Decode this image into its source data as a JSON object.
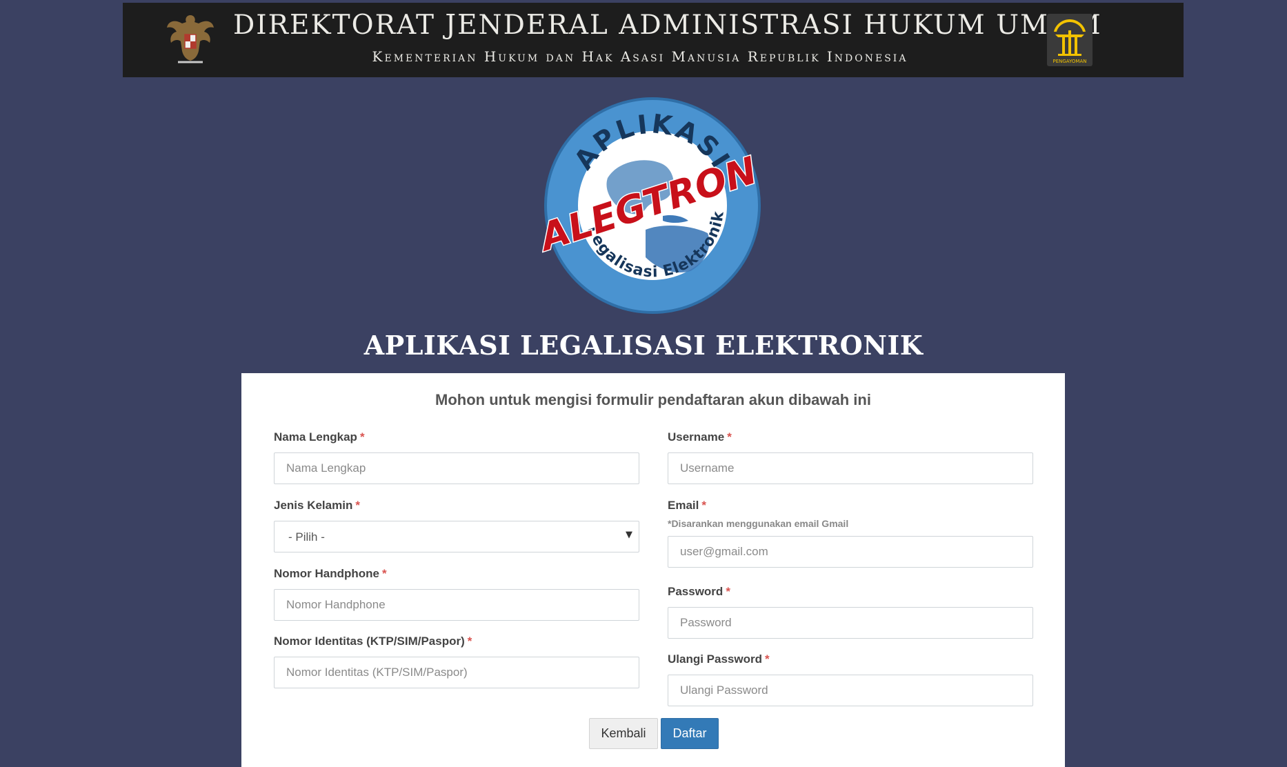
{
  "banner": {
    "title": "DIREKTORAT JENDERAL ADMINISTRASI HUKUM UMUM",
    "subtitle": "Kementerian Hukum dan Hak Asasi Manusia Republik Indonesia",
    "emblem_left": "garuda-pancasila-emblem",
    "emblem_right": "pengayoman-emblem",
    "emblem_right_label": "PENGAYOMAN"
  },
  "logo": {
    "top_text": "APLIKASI",
    "center_text": "ALEGTRON",
    "bottom_text": "Legalisasi Elektronik"
  },
  "app_title": "APLIKASI LEGALISASI ELEKTRONIK",
  "form": {
    "heading": "Mohon untuk mengisi formulir pendaftaran akun dibawah ini",
    "required_marker": "*",
    "fields": {
      "full_name": {
        "label": "Nama Lengkap",
        "placeholder": "Nama Lengkap",
        "value": ""
      },
      "gender": {
        "label": "Jenis Kelamin",
        "selected": "- Pilih -"
      },
      "phone": {
        "label": "Nomor Handphone",
        "placeholder": "Nomor Handphone",
        "value": ""
      },
      "id_number": {
        "label": "Nomor Identitas (KTP/SIM/Paspor)",
        "placeholder": "Nomor Identitas (KTP/SIM/Paspor)",
        "value": ""
      },
      "username": {
        "label": "Username",
        "placeholder": "Username",
        "value": ""
      },
      "email": {
        "label": "Email",
        "hint": "*Disarankan menggunakan email Gmail",
        "placeholder": "user@gmail.com",
        "value": ""
      },
      "password": {
        "label": "Password",
        "placeholder": "Password",
        "value": ""
      },
      "password_repeat": {
        "label": "Ulangi Password",
        "placeholder": "Ulangi Password",
        "value": ""
      }
    },
    "buttons": {
      "back": "Kembali",
      "submit": "Daftar"
    }
  },
  "colors": {
    "background": "#3b4162",
    "banner_bg": "#1d1d1d",
    "primary_button": "#337ab7",
    "required": "#d9534f",
    "logo_blue": "#4a93d0",
    "logo_red": "#c8101a"
  }
}
